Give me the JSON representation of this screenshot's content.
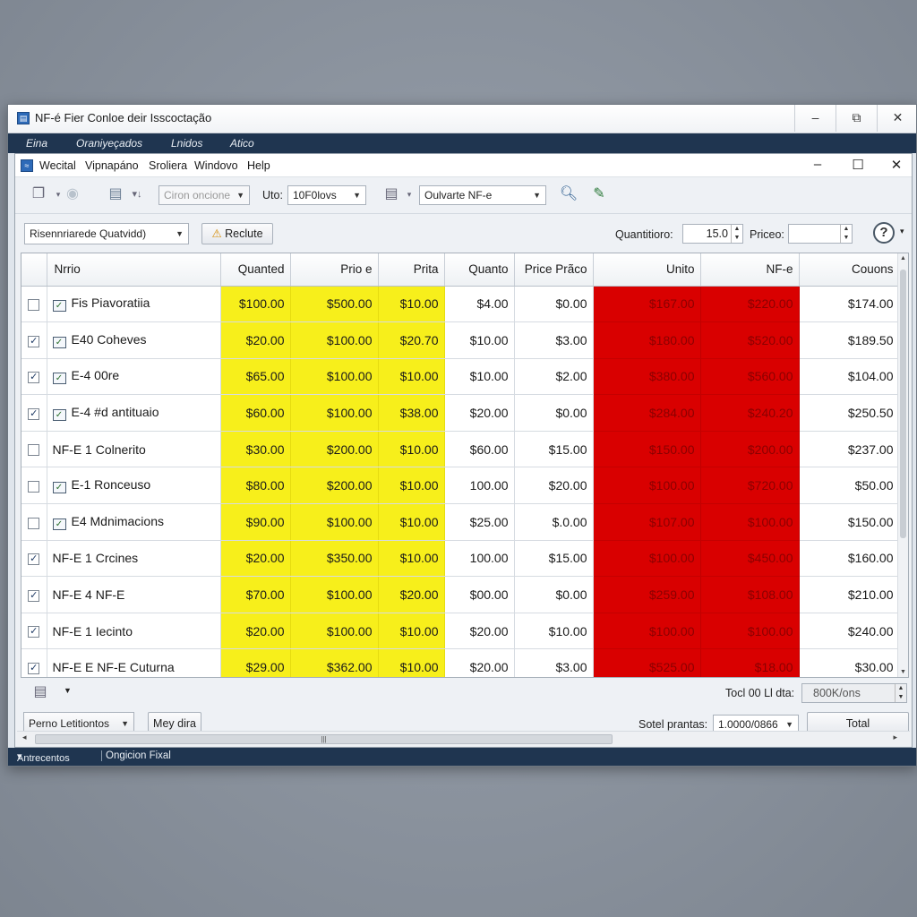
{
  "outer": {
    "title": "NF-é Fier Conloe deir Isscoctação",
    "menu": [
      "Eina",
      "Oraniyeçados",
      "Lnidos",
      "Atico"
    ],
    "status": {
      "left": "Antrecentos",
      "right": "Ongicion Fixal"
    }
  },
  "inner": {
    "menu": [
      "Wecital",
      "Vipnapáno",
      "Sroliera",
      "Windovo",
      "Help"
    ],
    "toolbar": {
      "disabled_combo": "Ciron oncione",
      "uto_label": "Uto:",
      "uto_value": "10F0lovs",
      "nfe_combo": "Oulvarte NF-e"
    },
    "filter": {
      "combo": "Risennriarede Quatvidd)",
      "warn_button": "Reclute",
      "quantity_label": "Quantitioro:",
      "quantity_value": "15.0",
      "price_label": "Priceo:",
      "price_value": ""
    },
    "columns": [
      "",
      "Nrrio",
      "Quanted",
      "Prio e",
      "Prita",
      "Quanto",
      "Price Prãco",
      "Unito",
      "NF-e",
      "Couons"
    ],
    "rows": [
      {
        "checked": false,
        "icon": true,
        "name": "Fis Piavoratiia",
        "c1": "$100.00",
        "c2": "$500.00",
        "c3": "$10.00",
        "c4": "$4.00",
        "c5": "$0.00",
        "c6": "$167.00",
        "c7": "$220.00",
        "c8": "$174.00"
      },
      {
        "checked": true,
        "icon": true,
        "name": "E40 Coheves",
        "c1": "$20.00",
        "c2": "$100.00",
        "c3": "$20.70",
        "c4": "$10.00",
        "c5": "$3.00",
        "c6": "$180.00",
        "c7": "$520.00",
        "c8": "$189.50"
      },
      {
        "checked": true,
        "icon": true,
        "name": "E-4 00re",
        "c1": "$65.00",
        "c2": "$100.00",
        "c3": "$10.00",
        "c4": "$10.00",
        "c5": "$2.00",
        "c6": "$380.00",
        "c7": "$560.00",
        "c8": "$104.00"
      },
      {
        "checked": true,
        "icon": true,
        "name": "E-4 #d antituaio",
        "c1": "$60.00",
        "c2": "$100.00",
        "c3": "$38.00",
        "c4": "$20.00",
        "c5": "$0.00",
        "c6": "$284.00",
        "c7": "$240.20",
        "c8": "$250.50"
      },
      {
        "checked": false,
        "icon": false,
        "name": "NF-E 1 Colnerito",
        "c1": "$30.00",
        "c2": "$200.00",
        "c3": "$10.00",
        "c4": "$60.00",
        "c5": "$15.00",
        "c6": "$150.00",
        "c7": "$200.00",
        "c8": "$237.00"
      },
      {
        "checked": false,
        "icon": true,
        "name": "E-1 Ronceuso",
        "c1": "$80.00",
        "c2": "$200.00",
        "c3": "$10.00",
        "c4": "100.00",
        "c5": "$20.00",
        "c6": "$100.00",
        "c7": "$720.00",
        "c8": "$50.00"
      },
      {
        "checked": false,
        "icon": true,
        "name": "E4 Mdnimacions",
        "c1": "$90.00",
        "c2": "$100.00",
        "c3": "$10.00",
        "c4": "$25.00",
        "c5": "$.0.00",
        "c6": "$107.00",
        "c7": "$100.00",
        "c8": "$150.00"
      },
      {
        "checked": true,
        "icon": false,
        "name": "NF-E 1 Crcines",
        "c1": "$20.00",
        "c2": "$350.00",
        "c3": "$10.00",
        "c4": "100.00",
        "c5": "$15.00",
        "c6": "$100.00",
        "c7": "$450.00",
        "c8": "$160.00"
      },
      {
        "checked": true,
        "icon": false,
        "name": "NF-E 4 NF-E",
        "c1": "$70.00",
        "c2": "$100.00",
        "c3": "$20.00",
        "c4": "$00.00",
        "c5": "$0.00",
        "c6": "$259.00",
        "c7": "$108.00",
        "c8": "$210.00"
      },
      {
        "checked": true,
        "icon": false,
        "name": "NF-E 1 Iecinto",
        "c1": "$20.00",
        "c2": "$100.00",
        "c3": "$10.00",
        "c4": "$20.00",
        "c5": "$10.00",
        "c6": "$100.00",
        "c7": "$100.00",
        "c8": "$240.00"
      },
      {
        "checked": true,
        "icon": false,
        "name": "NF-E E NF-E Cuturna",
        "c1": "$29.00",
        "c2": "$362.00",
        "c3": "$10.00",
        "c4": "$20.00",
        "c5": "$3.00",
        "c6": "$525.00",
        "c7": "$18.00",
        "c8": "$30.00"
      }
    ],
    "footer": {
      "total_label": "Tocl 00 Ll dta:",
      "total_value": "800K/ons",
      "left_combo": "Perno Letitiontos",
      "mey_button": "Mey dira",
      "sotel_label": "Sotel prantas:",
      "sotel_value": "1.0000/0866",
      "total_button": "Total"
    }
  },
  "colors": {
    "yellow": "#f7ef1b",
    "red": "#d90000",
    "titlebar_dark": "#1f3550"
  }
}
